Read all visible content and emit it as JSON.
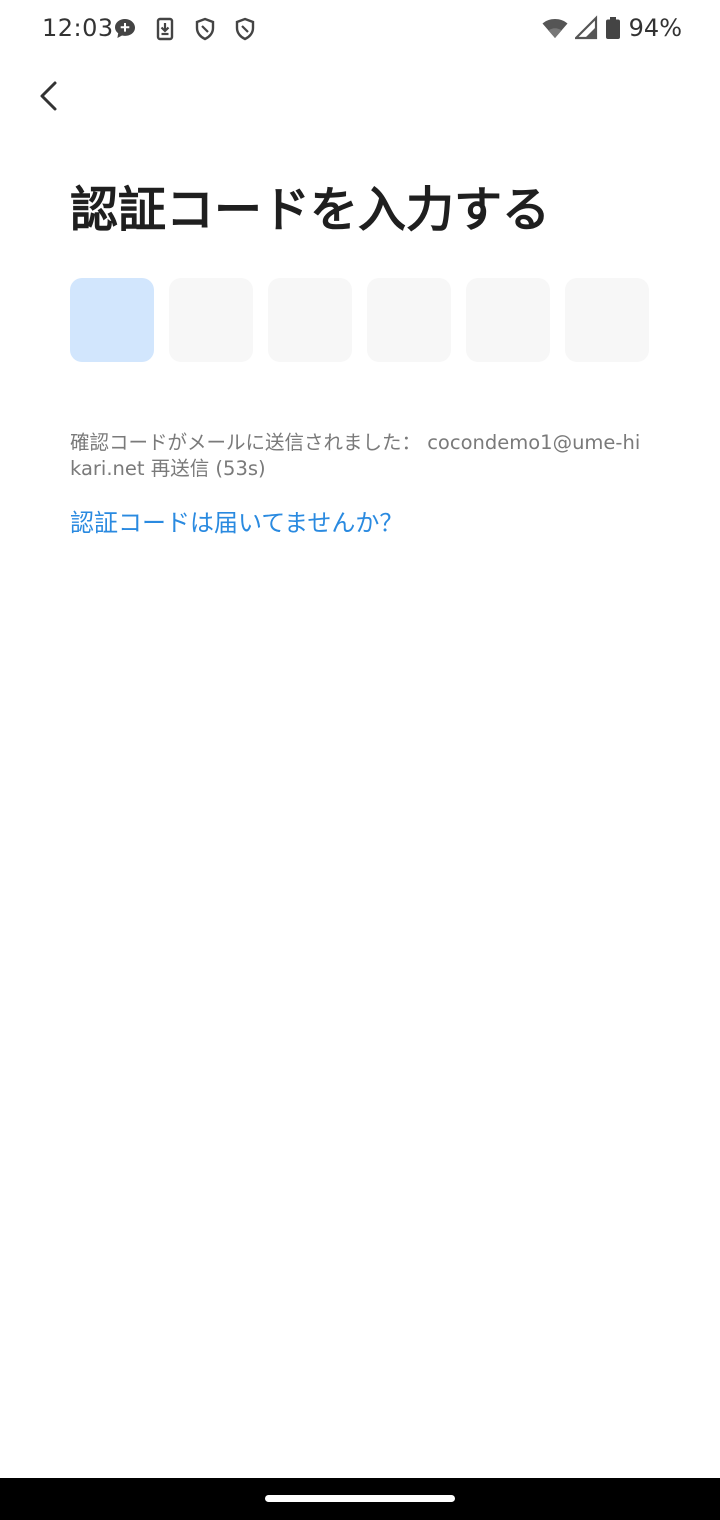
{
  "status_bar": {
    "time": "12:03",
    "battery_percent": "94%",
    "left_icons": [
      "chat-plus-icon",
      "download-icon",
      "shield-icon",
      "shield-icon"
    ],
    "right_icons": [
      "wifi-icon",
      "cellular-signal-icon",
      "battery-icon"
    ]
  },
  "header": {
    "back_icon": "chevron-left-icon"
  },
  "main": {
    "title": "認証コードを入力する",
    "code_length": 6,
    "active_box_index": 0,
    "sent_message": "確認コードがメールに送信されました： cocondemo1@ume-hikari.net 再送信 (53s)",
    "help_link": "認証コードは届いてませんか？"
  },
  "colors": {
    "accent": "#2a8ae0",
    "active_box": "#d2e6fd",
    "inactive_box": "#f7f7f7",
    "muted_text": "#7a7a7a"
  }
}
